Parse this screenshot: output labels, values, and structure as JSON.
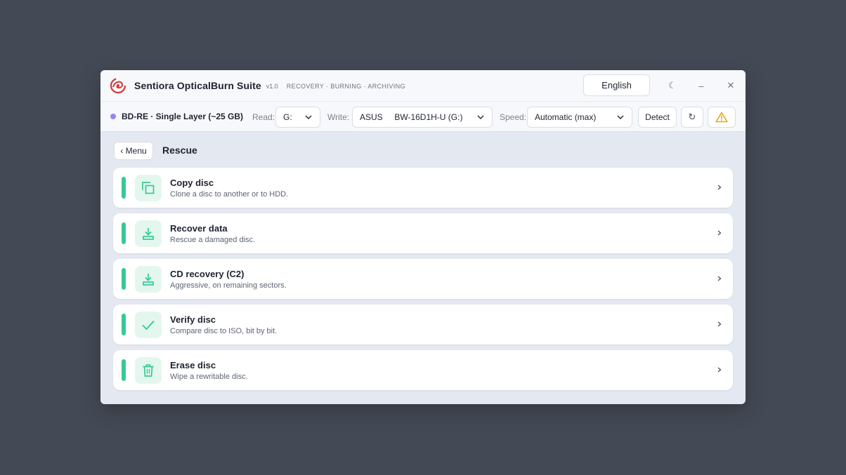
{
  "app": {
    "title": "Sentiora OpticalBurn Suite",
    "version": "v1.0",
    "tagline": "RECOVERY · BURNING · ARCHIVING",
    "language": "English",
    "theme_icon": "☾",
    "minimize_icon": "–",
    "close_icon": "✕"
  },
  "toolbar": {
    "disc_info": "BD-RE · Single Layer (~25 GB)",
    "read_label": "Read:",
    "read_value": "G:",
    "write_label": "Write:",
    "write_value": "ASUS     BW-16D1H-U (G:)",
    "speed_label": "Speed:",
    "speed_value": "Automatic (max)",
    "detect_label": "Detect",
    "refresh_icon": "↻"
  },
  "page": {
    "back_label": "‹ Menu",
    "title": "Rescue"
  },
  "actions": [
    {
      "title": "Copy disc",
      "description": "Clone a disc to another or to HDD.",
      "icon": "copy-icon"
    },
    {
      "title": "Recover data",
      "description": "Rescue a damaged disc.",
      "icon": "download-icon"
    },
    {
      "title": "CD recovery (C2)",
      "description": "Aggressive, on remaining sectors.",
      "icon": "download-icon"
    },
    {
      "title": "Verify disc",
      "description": "Compare disc to ISO, bit by bit.",
      "icon": "check-icon"
    },
    {
      "title": "Erase disc",
      "description": "Wipe a rewritable disc.",
      "icon": "trash-icon"
    }
  ],
  "colors": {
    "accent": "#37c994",
    "accent_soft": "#e3f7ee",
    "warning": "#e6a817",
    "logo_red": "#d23a3a"
  }
}
